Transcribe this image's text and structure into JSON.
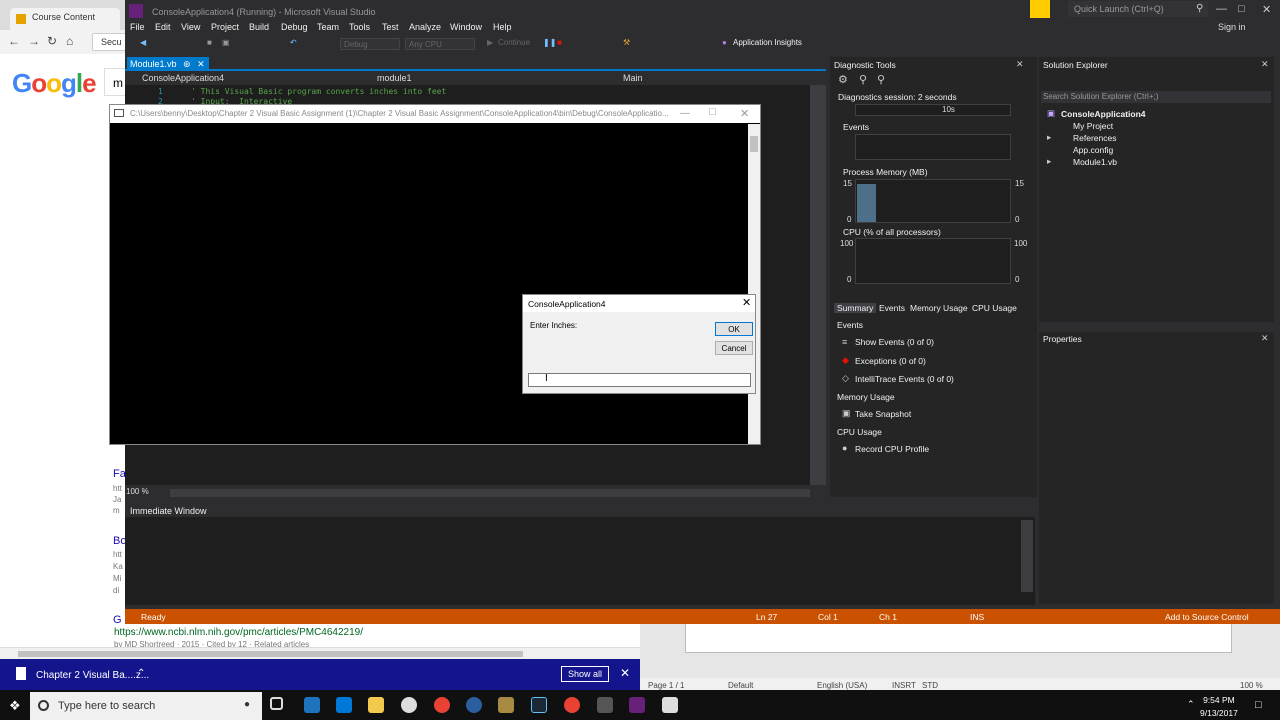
{
  "chrome": {
    "tab_title": "Course Content",
    "omnibox_text": "Secu",
    "search_query": "m",
    "results": [
      {
        "title_frag": "Fa",
        "lines": [
          "htt",
          "Ja",
          "m"
        ]
      },
      {
        "title_frag": "Bo",
        "lines": [
          "htt",
          "Ka",
          "Mi",
          "di"
        ]
      }
    ],
    "bottom_result": {
      "title_frag": "G",
      "url": "https://www.ncbi.nlm.nih.gov/pmc/articles/PMC4642219/",
      "cite": "by MD Shortreed · 2015 · Cited by 12 · Related articles"
    },
    "download": {
      "name": "Chapter 2 Visual Ba....z...",
      "show_all": "Show all"
    }
  },
  "vs": {
    "title": "ConsoleApplication4 (Running) - Microsoft Visual Studio",
    "quick_launch": "Quick Launch (Ctrl+Q)",
    "sign_in": "Sign in",
    "menu": [
      "File",
      "Edit",
      "View",
      "Project",
      "Build",
      "Debug",
      "Team",
      "Tools",
      "Test",
      "Analyze",
      "Window",
      "Help"
    ],
    "toolbar": {
      "config": "Debug",
      "platform": "Any CPU",
      "continue": "Continue",
      "app_insights": "Application Insights"
    },
    "doc_tab": "Module1.vb",
    "nav": {
      "project": "ConsoleApplication4",
      "module": "module1",
      "member": "Main"
    },
    "code_lines": [
      {
        "num": "1",
        "text": "' This Visual Basic program converts inches into feet"
      },
      {
        "num": "2",
        "text": "' Input:  Interactive"
      }
    ],
    "zoom": "100 %",
    "immediate_title": "Immediate Window",
    "status": {
      "state": "Ready",
      "ln": "Ln 27",
      "col": "Col 1",
      "ch": "Ch 1",
      "ins": "INS",
      "source_control": "Add to Source Control"
    }
  },
  "diagnostics": {
    "title": "Diagnostic Tools",
    "session": "Diagnostics session: 2 seconds",
    "timeline_label": "10s",
    "events_label": "Events",
    "process_memory": {
      "label": "Process Memory (MB)",
      "max": "15",
      "min": "0",
      "value_fraction": 0.9
    },
    "cpu": {
      "label": "CPU (% of all processors)",
      "max": "100",
      "min": "0"
    },
    "tabs": [
      "Summary",
      "Events",
      "Memory Usage",
      "CPU Usage"
    ],
    "summary": {
      "events_heading": "Events",
      "show_events": "Show Events (0 of 0)",
      "exceptions": "Exceptions (0 of 0)",
      "intellitrace": "IntelliTrace Events (0 of 0)",
      "memory_heading": "Memory Usage",
      "take_snapshot": "Take Snapshot",
      "cpu_heading": "CPU Usage",
      "record_cpu": "Record CPU Profile"
    }
  },
  "solution_explorer": {
    "title": "Solution Explorer",
    "search_placeholder": "Search Solution Explorer (Ctrl+;)",
    "items": [
      "ConsoleApplication4",
      "My Project",
      "References",
      "App.config",
      "Module1.vb"
    ]
  },
  "properties": {
    "title": "Properties"
  },
  "console": {
    "title": "C:\\Users\\benny\\Desktop\\Chapter 2 Visual Basic Assignment (1)\\Chapter 2 Visual Basic Assignment\\ConsoleApplication4\\bin\\Debug\\ConsoleApplicatio..."
  },
  "dialog": {
    "title": "ConsoleApplication4",
    "prompt": "Enter Inches:",
    "ok": "OK",
    "cancel": "Cancel",
    "value": ""
  },
  "word": {
    "page": "Page 1 / 1",
    "style": "Default",
    "language": "English (USA)",
    "insrt": "INSRT",
    "std": "STD",
    "zoom": "100 %"
  },
  "taskbar": {
    "search_placeholder": "Type here to search",
    "time": "9:54 PM",
    "date": "9/13/2017"
  },
  "colors": {
    "vs_accent": "#007acc",
    "vs_status": "#ca5100",
    "vs_purple": "#68217a",
    "download_bar": "#14148c"
  }
}
